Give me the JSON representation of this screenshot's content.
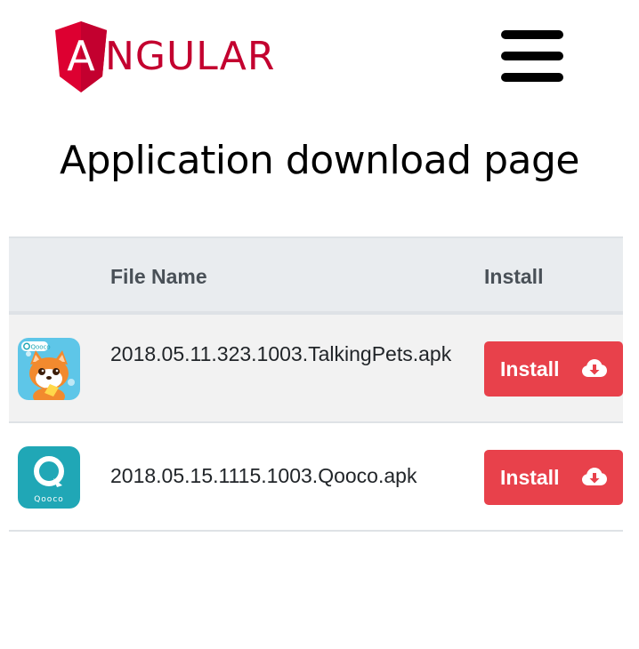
{
  "header": {
    "logo_text": "NGULAR",
    "logo_letter": "A"
  },
  "page": {
    "title": "Application download page"
  },
  "table": {
    "columns": [
      "",
      "File Name",
      "Install"
    ],
    "rows": [
      {
        "icon": "talkingpets-app-icon",
        "icon_text": "Qooco",
        "file_name": "2018.05.11.323.1003.TalkingPets.apk",
        "button_label": "Install"
      },
      {
        "icon": "qooco-app-icon",
        "icon_text": "Qooco",
        "file_name": "2018.05.15.1115.1003.Qooco.apk",
        "button_label": "Install"
      }
    ]
  },
  "colors": {
    "brand_red": "#c3002f",
    "button_red": "#e8414b",
    "header_bg": "#e9ecef",
    "stripe_bg": "#f2f2f2",
    "qooco_teal": "#20a7b6"
  }
}
